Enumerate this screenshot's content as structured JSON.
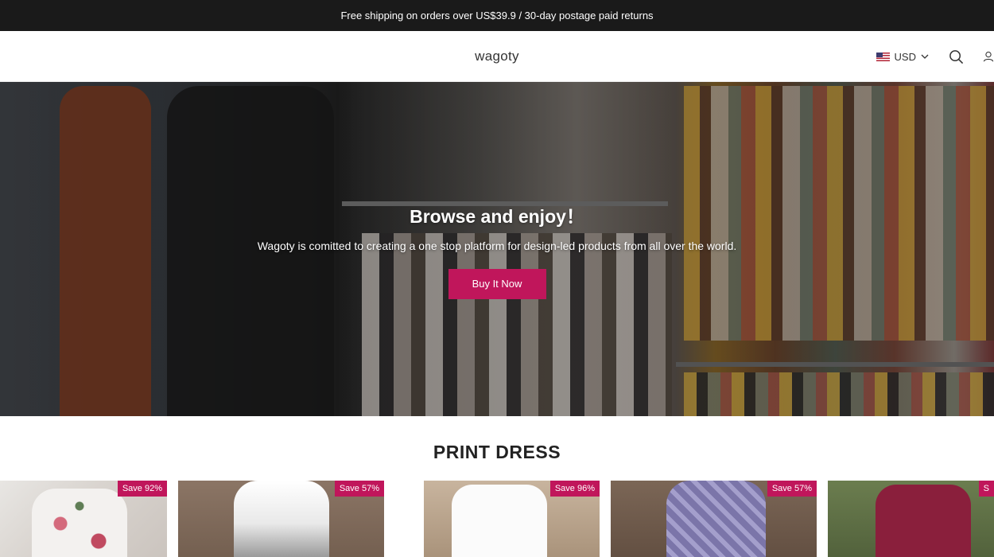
{
  "announcement": {
    "icon": "truck-icon",
    "text": "Free shipping on orders over US$39.9 / 30-day postage paid returns"
  },
  "header": {
    "logo": "wagoty",
    "currency": {
      "flag": "us-flag-icon",
      "label": "USD"
    },
    "icons": [
      "search-icon",
      "user-icon"
    ]
  },
  "hero": {
    "title": "Browse and enjoy！",
    "subtitle": "Wagoty is comitted to creating a one stop platform for design-led products from all over the world.",
    "button_label": "Buy It Now",
    "button_color": "#c0165b"
  },
  "section": {
    "title": "PRINT DRESS"
  },
  "products": [
    {
      "badge": "Save 92%"
    },
    {
      "badge": "Save 57%"
    },
    {
      "badge": "Save 96%"
    },
    {
      "badge": "Save 57%"
    },
    {
      "badge": "S"
    }
  ],
  "colors": {
    "announcement_bg": "#1a1a1a",
    "accent": "#c0165b"
  }
}
